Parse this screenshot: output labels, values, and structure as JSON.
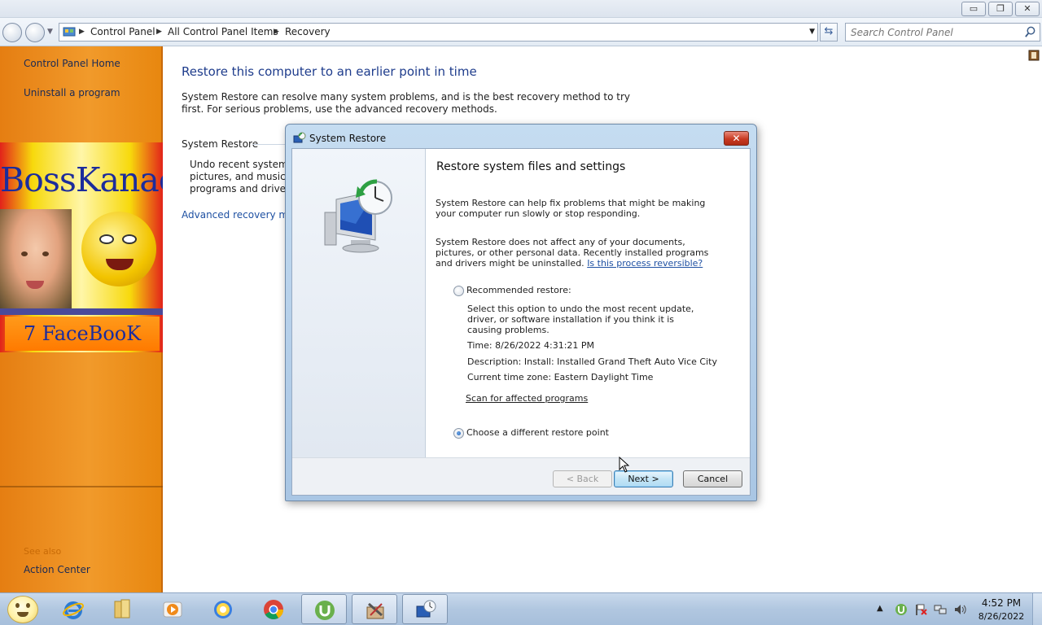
{
  "window": {
    "minimize_label": "▭",
    "maximize_label": "❐",
    "close_label": "✕"
  },
  "address": {
    "crumbs": [
      "Control Panel",
      "All Control Panel Items",
      "Recovery"
    ]
  },
  "search": {
    "placeholder": "Search Control Panel"
  },
  "sidebar": {
    "links": [
      {
        "label": "Control Panel Home"
      },
      {
        "label": "Uninstall a program"
      }
    ],
    "see_also": "See also",
    "see_also_links": [
      {
        "label": "Action Center"
      }
    ],
    "banner_title": "BossKanae",
    "banner_subtitle": "7 FaceBooK"
  },
  "main": {
    "title": "Restore this computer to an earlier point in time",
    "description": "System Restore can resolve many system problems, and is the best recovery method to try first. For serious problems, use the advanced recovery methods.",
    "section_title": "System Restore",
    "section_desc_lines": [
      "Undo recent system ch",
      "pictures, and music ur",
      "programs and drivers."
    ],
    "advanced_link": "Advanced recovery meth"
  },
  "dialog": {
    "title": "System Restore",
    "close_label": "✕",
    "heading": "Restore system files and settings",
    "para1": "System Restore can help fix problems that might be making your computer run slowly or stop responding.",
    "para2": "System Restore does not affect any of your documents, pictures, or other personal data. Recently installed programs and drivers might be uninstalled.",
    "para2_link": "Is this process reversible?",
    "option_recommended": {
      "label": "Recommended restore:",
      "selected": false,
      "desc": "Select this option to undo the most recent update, driver, or software installation if you think it is causing problems.",
      "time": "Time: 8/26/2022 4:31:21 PM",
      "description": "Description: Install: Installed Grand Theft Auto Vice City",
      "timezone": "Current time zone: Eastern Daylight Time",
      "scan_link": "Scan for affected programs"
    },
    "option_different": {
      "label": "Choose a different restore point",
      "selected": true
    },
    "buttons": {
      "back": "< Back",
      "next": "Next >",
      "cancel": "Cancel"
    }
  },
  "taskbar": {
    "items": [
      {
        "icon": "internet-explorer-icon"
      },
      {
        "icon": "folder-icon"
      },
      {
        "icon": "media-player-icon"
      },
      {
        "icon": "browser-ring-icon"
      },
      {
        "icon": "chrome-icon"
      },
      {
        "icon": "utorrent-icon"
      },
      {
        "icon": "tools-app-icon"
      },
      {
        "icon": "system-restore-icon"
      }
    ],
    "clock_time": "4:52 PM",
    "clock_date": "8/26/2022"
  },
  "colors": {
    "sidebar_orange": "#f19a2b",
    "link_blue": "#1e50a2",
    "title_blue": "#1e3c8c"
  }
}
